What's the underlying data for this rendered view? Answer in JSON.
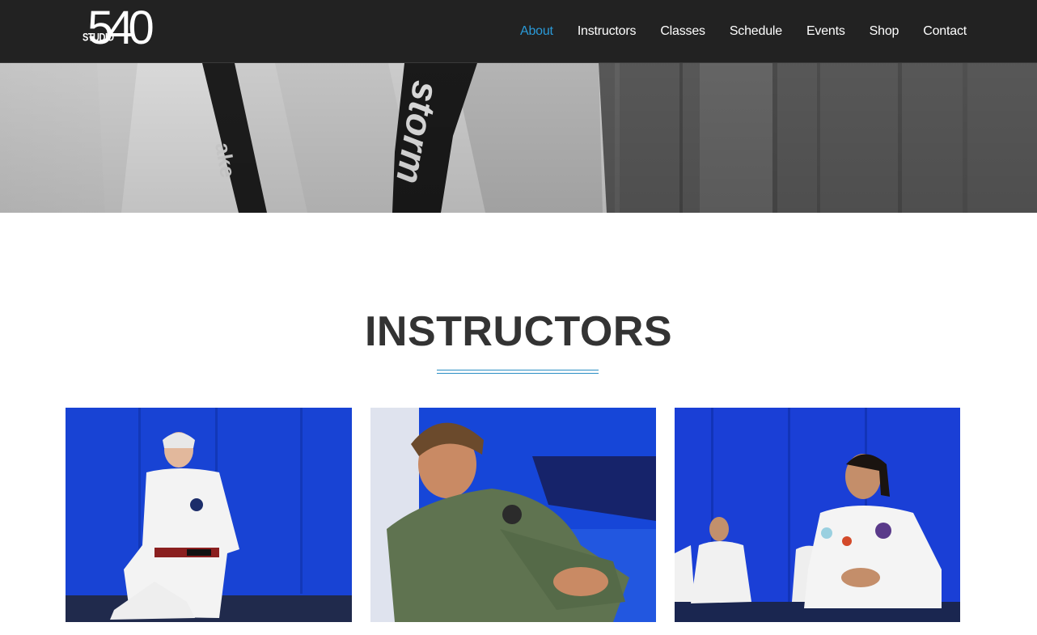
{
  "brand": {
    "logo_small": "STUDIO",
    "logo_number": "540"
  },
  "nav": {
    "items": [
      {
        "label": "About",
        "active": true
      },
      {
        "label": "Instructors",
        "active": false
      },
      {
        "label": "Classes",
        "active": false
      },
      {
        "label": "Schedule",
        "active": false
      },
      {
        "label": "Events",
        "active": false
      },
      {
        "label": "Shop",
        "active": false
      },
      {
        "label": "Contact",
        "active": false
      }
    ]
  },
  "colors": {
    "navbar_bg": "#222222",
    "nav_active": "#2a9ad8",
    "accent_rule": "#2a8ec4",
    "heading": "#333333",
    "mat_blue": "#1a3fd6"
  },
  "hero": {
    "kimono_patch_text": "storm"
  },
  "section": {
    "title": "INSTRUCTORS"
  },
  "instructors": [
    {
      "photo": "instructor-photo-1"
    },
    {
      "photo": "instructor-photo-2"
    },
    {
      "photo": "instructor-photo-3"
    }
  ]
}
